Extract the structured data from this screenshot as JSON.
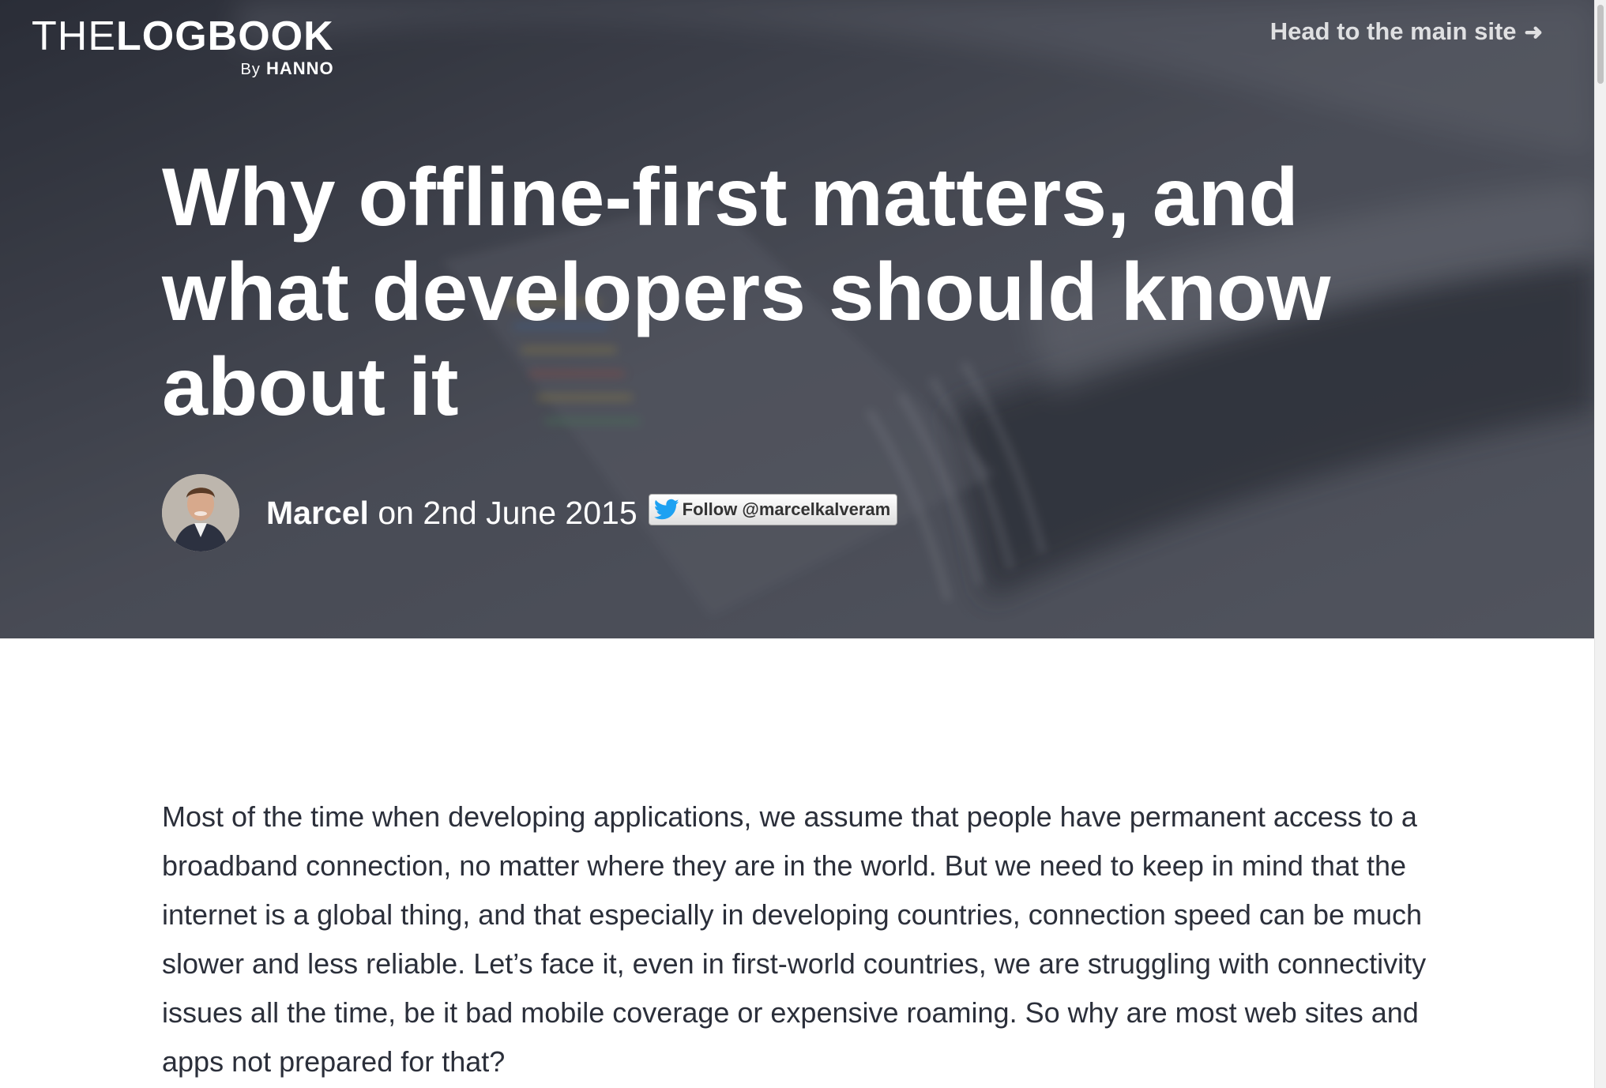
{
  "header": {
    "logo_the": "THE",
    "logo_logbook": "LOGBOOK",
    "logo_by": "By",
    "logo_hanno": "HANNO",
    "main_site_link": "Head to the main site",
    "arrow_icon": "arrow-right-icon"
  },
  "article": {
    "title": "Why offline-first matters, and what developers should know about it",
    "author": "Marcel",
    "date_text": "on 2nd June 2015",
    "follow_button": "Follow @marcelkalveram",
    "body_paragraph": "Most of the time when developing applications, we assume that people have permanent access to a broadband connection, no matter where they are in the world. But we need to keep in mind that the internet is a global thing, and that especially in developing countries, connection speed can be much slower and less reliable. Let’s face it, even in first-world countries, we are struggling with connectivity issues all the time, be it bad mobile coverage or expensive roaming. So why are most web sites and apps not prepared for that?"
  },
  "colors": {
    "hero_overlay": "#3b3e48",
    "body_text": "#2b2f3a",
    "twitter_blue": "#1da1f2"
  }
}
